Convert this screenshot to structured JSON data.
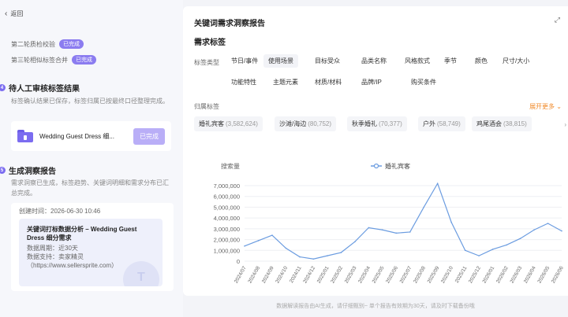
{
  "left": {
    "back_label": "返回",
    "rounds": [
      {
        "label": "第二轮质检校验",
        "badge": "已完成"
      },
      {
        "label": "第三轮相似标签合并",
        "badge": "已完成"
      }
    ],
    "step4": {
      "num": "4",
      "title": "待人工审核标签结果",
      "desc": "标签确认结果已保存，标签归属已按最终口径整理完成。"
    },
    "file": {
      "name": "Wedding Guest Dress 细...",
      "button": "已完成"
    },
    "step5": {
      "num": "5",
      "title": "生成洞察报告",
      "desc": "需求洞察已生成，标签趋势、关键词明细和需求分布已汇总完成。"
    },
    "report": {
      "created": "创建时间：2026-06-30 10:46",
      "title": "关键词打标数据分析 – Wedding Guest Dress 细分需求",
      "period": "数据周期：近30天",
      "support": "数据支持：卖家精灵",
      "url": "（https://www.sellersprite.com）"
    }
  },
  "right": {
    "title": "关键词需求洞察报告",
    "expand_icon": "expand-icon",
    "section": "需求标签",
    "label_type": "标签类型",
    "tags_row1": [
      "节日/事件",
      "使用场景",
      "目标受众",
      "品类名称",
      "风格款式",
      "季节",
      "颜色",
      "尺寸/大小"
    ],
    "tags_row2": [
      "功能特性",
      "主题元素",
      "材质/材料",
      "品牌/IP",
      "购买条件"
    ],
    "selected_tag": "使用场景",
    "category_label": "归属标签",
    "more": "展开更多 ⌄",
    "chips": [
      {
        "name": "婚礼宾客",
        "count": "(3,582,624)"
      },
      {
        "name": "沙滩/海边",
        "count": "(80,752)"
      },
      {
        "name": "秋季婚礼",
        "count": "(70,377)"
      },
      {
        "name": "户外",
        "count": "(58,749)"
      },
      {
        "name": "鸡尾酒会",
        "count": "(38,815)"
      }
    ],
    "chips_more": "›"
  },
  "chart_data": {
    "type": "line",
    "ylabel": "搜索量",
    "legend": "婚礼宾客",
    "legend_position": "top-center",
    "ylim": [
      0,
      7000000
    ],
    "yticks": [
      "7,000,000",
      "6,000,000",
      "5,000,000",
      "4,000,000",
      "3,000,000",
      "2,000,000",
      "1,000,000",
      "0"
    ],
    "categories": [
      "2024/07",
      "2024/08",
      "2024/09",
      "2024/10",
      "2024/11",
      "2024/12",
      "2025/01",
      "2025/02",
      "2025/03",
      "2025/04",
      "2025/05",
      "2025/06",
      "2025/07",
      "2025/08",
      "2025/09",
      "2025/10",
      "2025/11",
      "2025/12",
      "2026/01",
      "2026/02",
      "2026/03",
      "2026/04",
      "2026/05",
      "2026/06"
    ],
    "values": [
      1400000,
      1900000,
      2400000,
      1200000,
      400000,
      200000,
      500000,
      800000,
      1800000,
      3100000,
      2900000,
      2600000,
      2700000,
      5000000,
      7200000,
      3600000,
      1000000,
      500000,
      1100000,
      1500000,
      2100000,
      2900000,
      3500000,
      2800000
    ],
    "color": "#6b9ce0",
    "grid": true
  },
  "footer": "数据解读报告由AI生成，请仔细甄别~  单个报告有效期为30天，请及时下载备份哦"
}
